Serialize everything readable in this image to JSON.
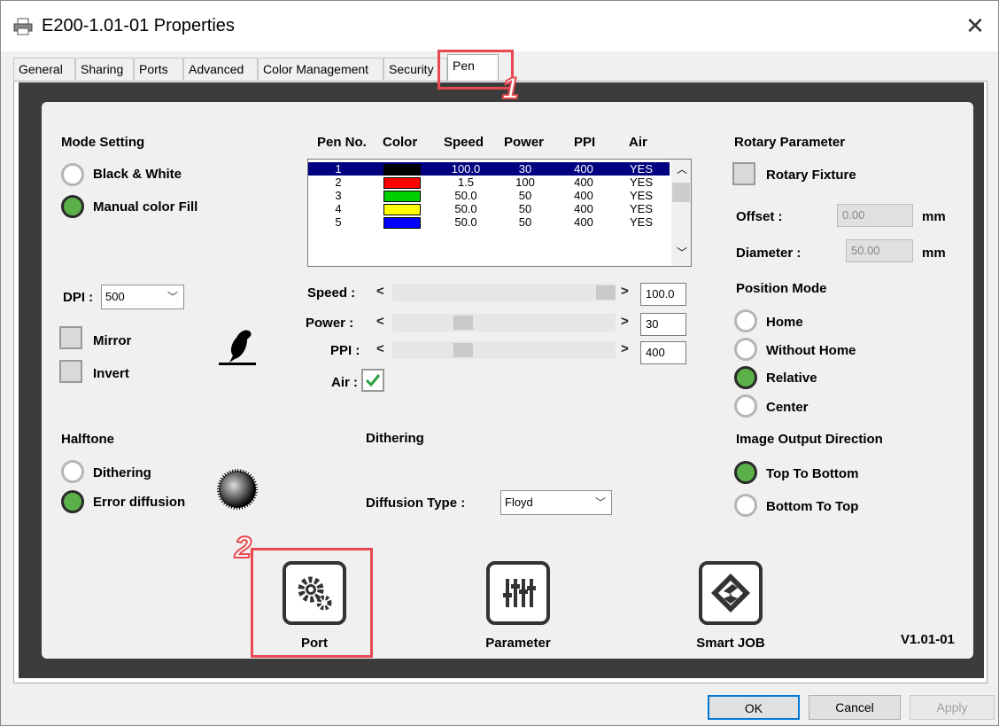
{
  "window": {
    "title": "E200-1.01-01 Properties",
    "close": "✕"
  },
  "tabs": [
    "General",
    "Sharing",
    "Ports",
    "Advanced",
    "Color Management",
    "Security",
    "Pen"
  ],
  "mode": {
    "header": "Mode Setting",
    "options": [
      "Black & White",
      "Manual color Fill"
    ],
    "selected": 1
  },
  "dpi": {
    "label": "DPI :",
    "value": "500"
  },
  "mirror": {
    "label": "Mirror",
    "checked": false
  },
  "invert": {
    "label": "Invert",
    "checked": false
  },
  "pen_table": {
    "headers": [
      "Pen No.",
      "Color",
      "Speed",
      "Power",
      "PPI",
      "Air"
    ],
    "rows": [
      {
        "no": "1",
        "color": "#000000",
        "speed": "100.0",
        "power": "30",
        "ppi": "400",
        "air": "YES"
      },
      {
        "no": "2",
        "color": "#ff0000",
        "speed": "1.5",
        "power": "100",
        "ppi": "400",
        "air": "YES"
      },
      {
        "no": "3",
        "color": "#00d000",
        "speed": "50.0",
        "power": "50",
        "ppi": "400",
        "air": "YES"
      },
      {
        "no": "4",
        "color": "#ffff00",
        "speed": "50.0",
        "power": "50",
        "ppi": "400",
        "air": "YES"
      },
      {
        "no": "5",
        "color": "#0000ff",
        "speed": "50.0",
        "power": "50",
        "ppi": "400",
        "air": "YES"
      }
    ],
    "selected_row": 0
  },
  "sliders": {
    "speed": {
      "label": "Speed :",
      "value": "100.0",
      "level": 1.0
    },
    "power": {
      "label": "Power :",
      "value": "30",
      "level": 0.3
    },
    "ppi": {
      "label": "PPI :",
      "value": "400",
      "level": 0.3
    }
  },
  "air": {
    "label": "Air :",
    "checked": true
  },
  "halftone": {
    "header": "Halftone",
    "options": [
      "Dithering",
      "Error diffusion"
    ],
    "selected": 1
  },
  "dithering": {
    "header": "Dithering",
    "diffusion_label": "Diffusion Type :",
    "diffusion_value": "Floyd"
  },
  "rotary": {
    "header": "Rotary Parameter",
    "fixture_label": "Rotary Fixture",
    "offset_label": "Offset :",
    "offset_value": "0.00",
    "diameter_label": "Diameter :",
    "diameter_value": "50.00",
    "unit": "mm"
  },
  "position_mode": {
    "header": "Position Mode",
    "options": [
      "Home",
      "Without Home",
      "Relative",
      "Center"
    ],
    "selected": 2
  },
  "image_output": {
    "header": "Image Output Direction",
    "options": [
      "Top To Bottom",
      "Bottom To Top"
    ],
    "selected": 0
  },
  "buttons": {
    "port": "Port",
    "parameter": "Parameter",
    "smart_job": "Smart JOB"
  },
  "version": "V1.01-01",
  "dialog": {
    "ok": "OK",
    "cancel": "Cancel",
    "apply": "Apply"
  },
  "callouts": {
    "one": "1",
    "two": "2"
  },
  "colors": {
    "accent_green": "#5bb04a",
    "selection_blue": "#000080",
    "callout_red": "#e8484f"
  }
}
